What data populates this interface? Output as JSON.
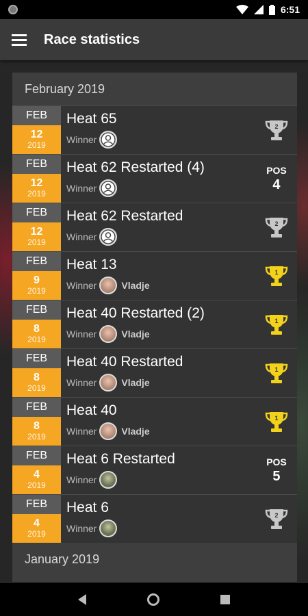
{
  "status_bar": {
    "time": "6:51"
  },
  "app_bar": {
    "title": "Race statistics"
  },
  "sections": [
    {
      "header": "February 2019",
      "rows": [
        {
          "month": "FEB",
          "day": "12",
          "year": "2019",
          "name": "Heat 65",
          "winner_label": "Winner",
          "winner_name": "",
          "avatar": "blank",
          "result": "trophy-silver"
        },
        {
          "month": "FEB",
          "day": "12",
          "year": "2019",
          "name": "Heat 62 Restarted (4)",
          "winner_label": "Winner",
          "winner_name": "",
          "avatar": "blank",
          "result": "pos",
          "pos_label": "POS",
          "pos_value": "4"
        },
        {
          "month": "FEB",
          "day": "12",
          "year": "2019",
          "name": "Heat 62 Restarted",
          "winner_label": "Winner",
          "winner_name": "",
          "avatar": "blank",
          "result": "trophy-silver"
        },
        {
          "month": "FEB",
          "day": "9",
          "year": "2019",
          "name": "Heat 13",
          "winner_label": "Winner",
          "winner_name": "Vladje",
          "avatar": "photo",
          "result": "trophy-gold"
        },
        {
          "month": "FEB",
          "day": "8",
          "year": "2019",
          "name": "Heat 40 Restarted (2)",
          "winner_label": "Winner",
          "winner_name": "Vladje",
          "avatar": "photo",
          "result": "trophy-gold"
        },
        {
          "month": "FEB",
          "day": "8",
          "year": "2019",
          "name": "Heat 40 Restarted",
          "winner_label": "Winner",
          "winner_name": "Vladje",
          "avatar": "photo",
          "result": "trophy-gold"
        },
        {
          "month": "FEB",
          "day": "8",
          "year": "2019",
          "name": "Heat 40",
          "winner_label": "Winner",
          "winner_name": "Vladje",
          "avatar": "photo",
          "result": "trophy-gold"
        },
        {
          "month": "FEB",
          "day": "4",
          "year": "2019",
          "name": "Heat 6 Restarted",
          "winner_label": "Winner",
          "winner_name": "",
          "avatar": "photo2",
          "result": "pos",
          "pos_label": "POS",
          "pos_value": "5"
        },
        {
          "month": "FEB",
          "day": "4",
          "year": "2019",
          "name": "Heat 6",
          "winner_label": "Winner",
          "winner_name": "",
          "avatar": "photo2",
          "result": "trophy-silver"
        }
      ]
    },
    {
      "header": "January 2019",
      "rows": []
    }
  ],
  "icons": {
    "menu": "menu-icon",
    "trophy_gold_color": "#f2d21b",
    "trophy_silver_color": "#c8c8c8"
  },
  "colors": {
    "date_accent": "#f5a623",
    "app_bar": "#3a3a3a",
    "card": "#3e3e3e"
  }
}
